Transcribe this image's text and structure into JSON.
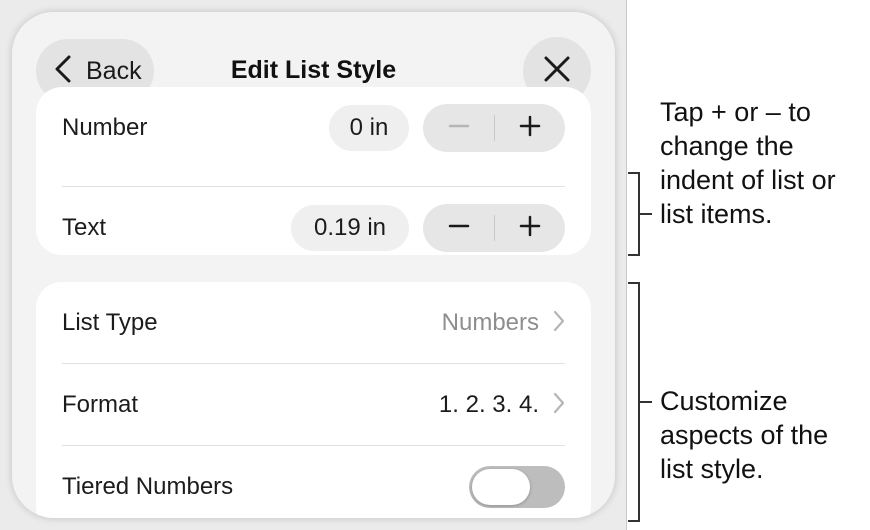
{
  "nav": {
    "back_label": "Back",
    "title": "Edit List Style",
    "close_icon": "close-icon",
    "back_icon": "chevron-left-icon"
  },
  "indents": {
    "number": {
      "label": "Number",
      "value": "0 in",
      "minus_enabled": false
    },
    "text": {
      "label": "Text",
      "value": "0.19 in",
      "minus_enabled": true
    }
  },
  "list_options": {
    "list_type": {
      "label": "List Type",
      "value": "Numbers"
    },
    "format": {
      "label": "Format",
      "value": "1. 2. 3. 4."
    },
    "tiered_numbers": {
      "label": "Tiered Numbers",
      "on": false
    }
  },
  "callouts": {
    "indent": "Tap + or – to change the indent of list or list items.",
    "customize": "Customize aspects of the list style."
  },
  "colors": {
    "panel_bg": "#f3f3f3",
    "card_bg": "#ffffff",
    "pill_bg": "#efefef",
    "disabled": "#b5b5b5",
    "secondary_text": "#8e8e8e"
  }
}
